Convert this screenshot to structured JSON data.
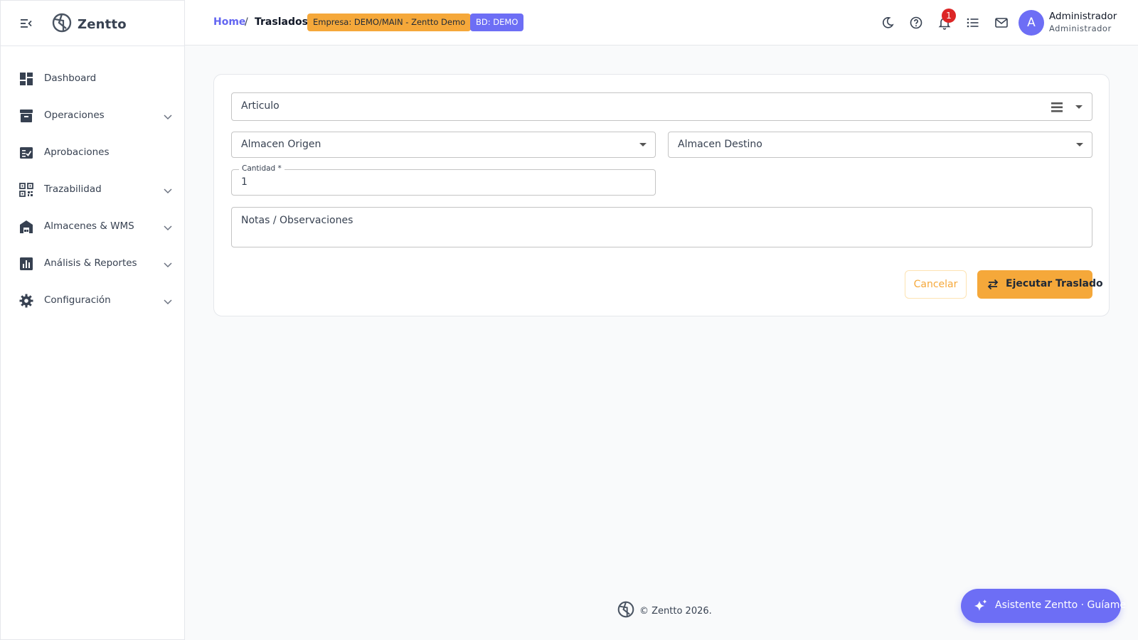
{
  "sidebar": {
    "brand": "Zentto",
    "items": [
      {
        "label": "Dashboard",
        "icon": "dashboard-icon",
        "expandable": false
      },
      {
        "label": "Operaciones",
        "icon": "archive-icon",
        "expandable": true
      },
      {
        "label": "Aprobaciones",
        "icon": "approval-icon",
        "expandable": false
      },
      {
        "label": "Trazabilidad",
        "icon": "qr-code-icon",
        "expandable": true
      },
      {
        "label": "Almacenes & WMS",
        "icon": "warehouse-icon",
        "expandable": true
      },
      {
        "label": "Análisis & Reportes",
        "icon": "bar-chart-icon",
        "expandable": true
      },
      {
        "label": "Configuración",
        "icon": "gear-icon",
        "expandable": true
      }
    ]
  },
  "header": {
    "breadcrumb": {
      "home": "Home",
      "separator": "/",
      "current": "Traslados"
    },
    "empresa_chip": "Empresa: DEMO/MAIN - Zentto Demo",
    "bd_chip": "BD: DEMO",
    "notification_count": "1",
    "user": {
      "initial": "A",
      "name": "Administrador",
      "role": "Administrador"
    }
  },
  "form": {
    "articulo": {
      "placeholder": "Articulo"
    },
    "almacen_origen": {
      "placeholder": "Almacen Origen"
    },
    "almacen_destino": {
      "placeholder": "Almacen Destino"
    },
    "cantidad": {
      "label": "Cantidad *",
      "value": "1"
    },
    "notas": {
      "placeholder": "Notas / Observaciones"
    },
    "cancel_label": "Cancelar",
    "execute_label": "Ejecutar Traslado"
  },
  "footer": {
    "text": "© Zentto 2026."
  },
  "assistant": {
    "label": "Asistente Zentto · Guíame"
  },
  "colors": {
    "accent": "#f5a83a",
    "brand": "#6d6ef5",
    "badge": "#dc2626"
  }
}
